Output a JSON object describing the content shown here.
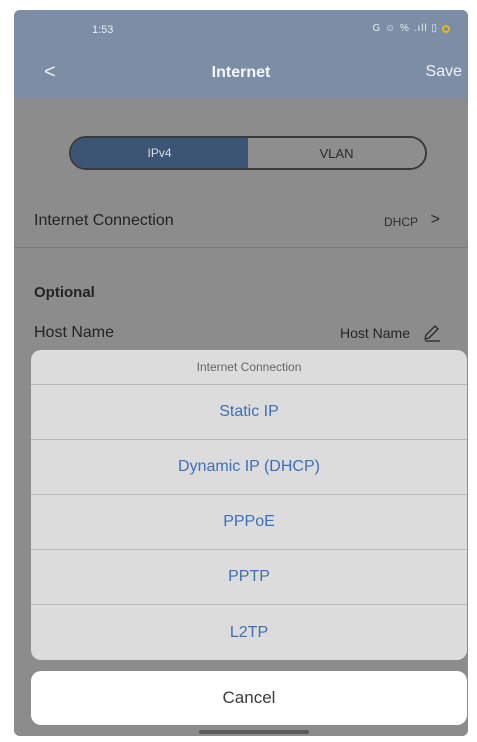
{
  "status_bar": {
    "time": "1:53",
    "icons": "G ☺ % .ıll ▯"
  },
  "nav": {
    "back": "<",
    "title": "Internet",
    "save": "Save"
  },
  "tabs": [
    {
      "label": "IPv4",
      "active": true
    },
    {
      "label": "VLAN",
      "active": false
    }
  ],
  "connection_row": {
    "label": "Internet Connection",
    "value": "DHCP",
    "chevron": ">"
  },
  "optional": {
    "title": "Optional",
    "host_name_label": "Host Name",
    "host_name_placeholder": "Host Name"
  },
  "action_sheet": {
    "title": "Internet Connection",
    "options": [
      "Static IP",
      "Dynamic IP (DHCP)",
      "PPPoE",
      "PPTP",
      "L2TP"
    ],
    "cancel": "Cancel"
  },
  "colors": {
    "header": "#7b8ea6",
    "segment_active": "#3d5575",
    "option_text": "#3d6fb8",
    "overlay": "#8c8c8c"
  }
}
